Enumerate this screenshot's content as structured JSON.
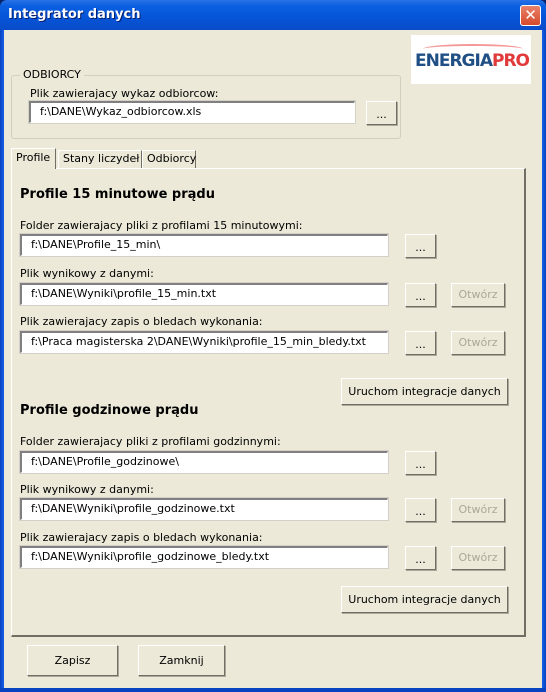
{
  "window": {
    "title": "Integrator danych",
    "close_glyph": "✕"
  },
  "logo": {
    "part1": "ENERGIA",
    "part2": "PRO",
    "colors": {
      "primary": "#1f4f85",
      "accent": "#e03a3a"
    }
  },
  "odbiorcy_group": {
    "legend": "ODBIORCY",
    "file_label": "Plik zawierajacy wykaz odbiorcow:",
    "file_value": "f:\\DANE\\Wykaz_odbiorcow.xls",
    "browse_label": "..."
  },
  "tabs": [
    {
      "label": "Profile",
      "active": true
    },
    {
      "label": "Stany liczydeł",
      "active": false
    },
    {
      "label": "Odbiorcy",
      "active": false
    }
  ],
  "section_15min": {
    "heading": "Profile 15 minutowe prądu",
    "folder_label": "Folder zawierajacy pliki z profilami 15 minutowymi:",
    "folder_value": "f:\\DANE\\Profile_15_min\\",
    "output_label": "Plik wynikowy z danymi:",
    "output_value": "f:\\DANE\\Wyniki\\profile_15_min.txt",
    "errors_label": "Plik zawierajacy zapis o bledach wykonania:",
    "errors_value": "f:\\Praca magisterska 2\\DANE\\Wyniki\\profile_15_min_bledy.txt",
    "browse_label": "...",
    "open_label": "Otwórz",
    "run_label": "Uruchom integracje danych"
  },
  "section_hourly": {
    "heading": "Profile godzinowe prądu",
    "folder_label": "Folder zawierajacy pliki z profilami godzinnymi:",
    "folder_value": "f:\\DANE\\Profile_godzinowe\\",
    "output_label": "Plik wynikowy z danymi:",
    "output_value": "f:\\DANE\\Wyniki\\profile_godzinowe.txt",
    "errors_label": "Plik zawierajacy zapis o bledach wykonania:",
    "errors_value": "f:\\DANE\\Wyniki\\profile_godzinowe_bledy.txt",
    "browse_label": "...",
    "open_label": "Otwórz",
    "run_label": "Uruchom integracje danych"
  },
  "footer": {
    "save_label": "Zapisz",
    "close_label": "Zamknij"
  }
}
